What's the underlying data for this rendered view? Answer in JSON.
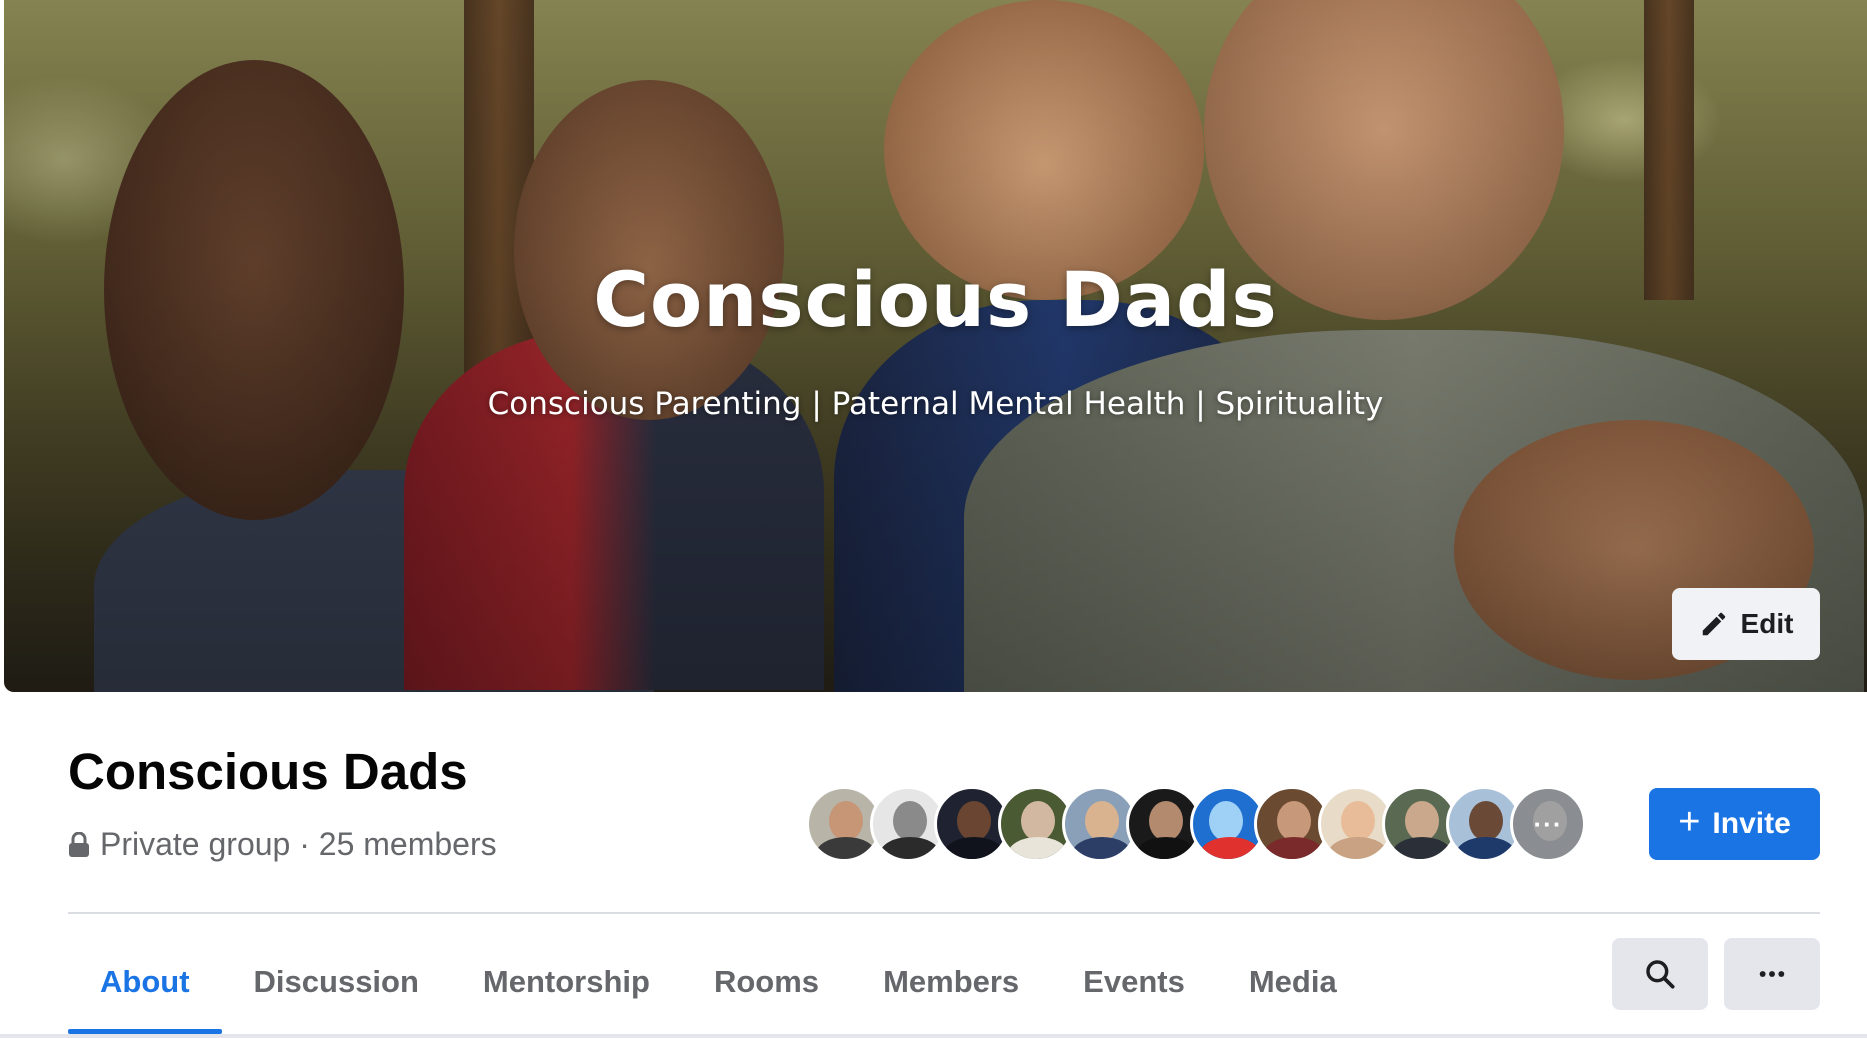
{
  "cover": {
    "title": "Conscious Dads",
    "subtitle": "Conscious Parenting | Paternal Mental Health | Spirituality",
    "edit_label": "Edit"
  },
  "group": {
    "name": "Conscious Dads",
    "meta": "Private group · 25 members",
    "privacy_icon": "lock-icon"
  },
  "members_preview": {
    "avatar_count": 12,
    "more_label": "···"
  },
  "actions": {
    "invite_label": "Invite"
  },
  "tabs": [
    {
      "label": "About",
      "active": true
    },
    {
      "label": "Discussion",
      "active": false
    },
    {
      "label": "Mentorship",
      "active": false
    },
    {
      "label": "Rooms",
      "active": false
    },
    {
      "label": "Members",
      "active": false
    },
    {
      "label": "Events",
      "active": false
    },
    {
      "label": "Media",
      "active": false
    }
  ],
  "colors": {
    "accent": "#1b74e4",
    "muted_text": "#65676b",
    "button_gray": "#e4e6eb"
  }
}
